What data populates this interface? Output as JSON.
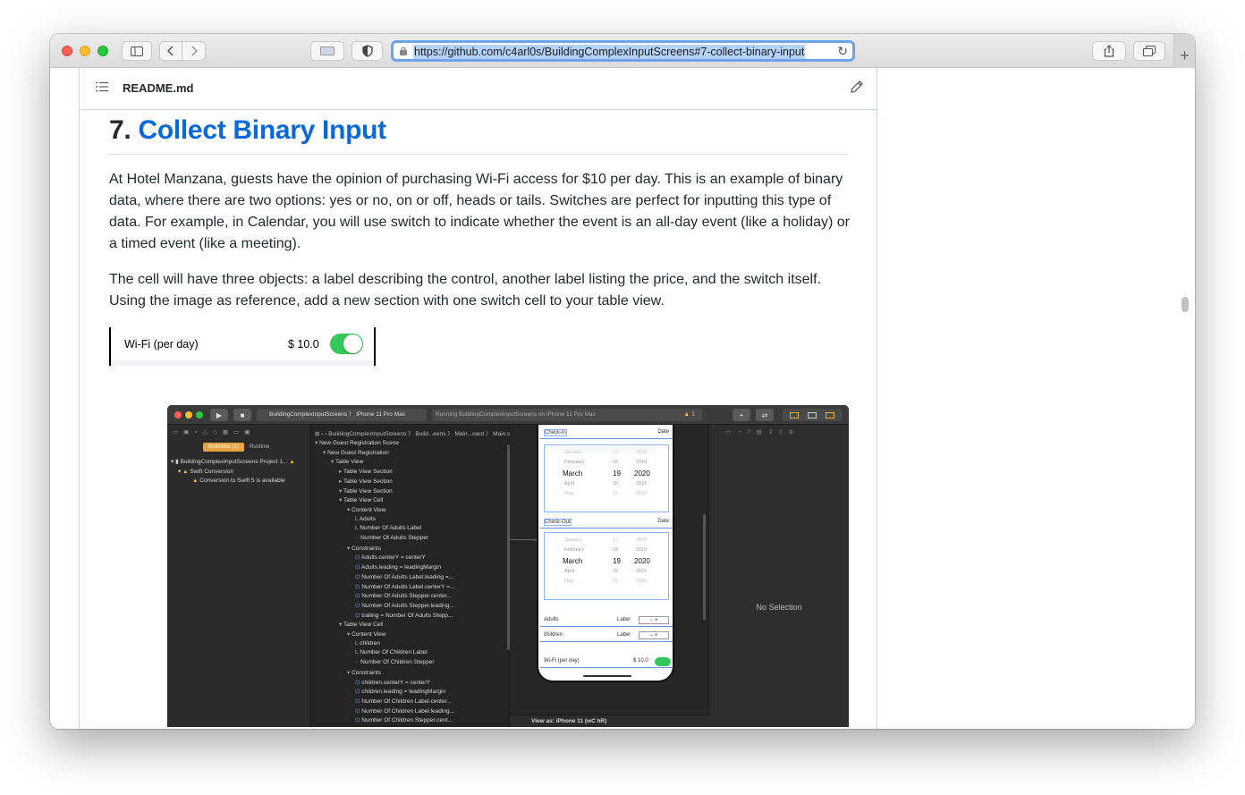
{
  "browser": {
    "url": "https://github.com/c4arl0s/BuildingComplexInputScreens#7-collect-binary-input",
    "new_tab_symbol": "+"
  },
  "readme": {
    "file_name": "README.md",
    "heading_number": "7.",
    "heading_link": "Collect Binary Input",
    "paragraph_1": "At Hotel Manzana, guests have the opinion of purchasing Wi-Fi access for $10 per day. This is an example of binary data, where there are two options: yes or no, on or off, heads or tails. Switches are perfect for inputting this type of data. For example, in Calendar, you will use switch to indicate whether the event is an all-day event (like a holiday) or a timed event (like a meeting).",
    "paragraph_2": "The cell will have three objects: a label describing the control, another label listing the price, and the switch itself. Using the image as reference, add a new section with one switch cell to your table view."
  },
  "wifi_cell": {
    "label": "Wi-Fi (per day)",
    "price": "$ 10.0",
    "switch_on": true
  },
  "xcode": {
    "scheme": "BuildingComplexInputScreens 〉 iPhone 11 Pro Max",
    "status": "Running BuildingComplexInputScreens on iPhone 11 Pro Max",
    "warning_count": "1",
    "nav_tabs": {
      "buildtime": "Buildtime (1)",
      "runtime": "Runtime"
    },
    "issues": [
      "BuildingComplexInputScreens Project 1...",
      "Swift Conversion",
      "Conversion to Swift 5 is available"
    ],
    "breadcrumb": "BuildingComplexInputScreens 〉 Build...eens 〉 Main...oard 〉 Main.storyboard (Base) 〉 No Selection",
    "outline": [
      "New Guest Registration Scene",
      "New Guest Registration",
      "Table View",
      "Table View Section",
      "Table View Section",
      "Table View Section",
      "Table View Cell",
      "Content View",
      "Adults",
      "Number Of Adults Label",
      "Number Of Adults Stepper",
      "Constraints",
      "Adults.centerY = centerY",
      "Adults.leading = leadingMargin",
      "Number Of Adults Label.leading =...",
      "Number Of Adults Label.centerY =...",
      "Number Of Adults Stepper.center...",
      "Number Of Adults Stepper.leading...",
      "trailing = Number Of Adults Stepp...",
      "Table View Cell",
      "Content View",
      "children",
      "Number Of Children Label",
      "Number Of Children Stepper",
      "Constraints",
      "children.centerY = centerY",
      "children.leading = leadingMargin",
      "Number Of Children Label.center...",
      "Number Of Children Label.leading...",
      "Number Of Children Stepper.cent..."
    ],
    "canvas": {
      "check_in": "Check-in",
      "check_out": "Check-Out",
      "date": "Date",
      "picker_months": [
        "January",
        "February",
        "March",
        "April",
        "May"
      ],
      "picker_days": [
        "17",
        "18",
        "19",
        "20",
        "21"
      ],
      "picker_years": [
        "2018",
        "2019",
        "2020",
        "2021",
        "2022"
      ],
      "adults": "Adults",
      "children": "children",
      "label": "Label",
      "wifi": "Wi-Fi (per day)",
      "wifi_price": "$ 10.0",
      "stepper_minus": "−",
      "stepper_plus": "+",
      "view_as": "View as: iPhone 11 (wC hR)"
    },
    "inspector": {
      "no_selection": "No Selection"
    }
  }
}
